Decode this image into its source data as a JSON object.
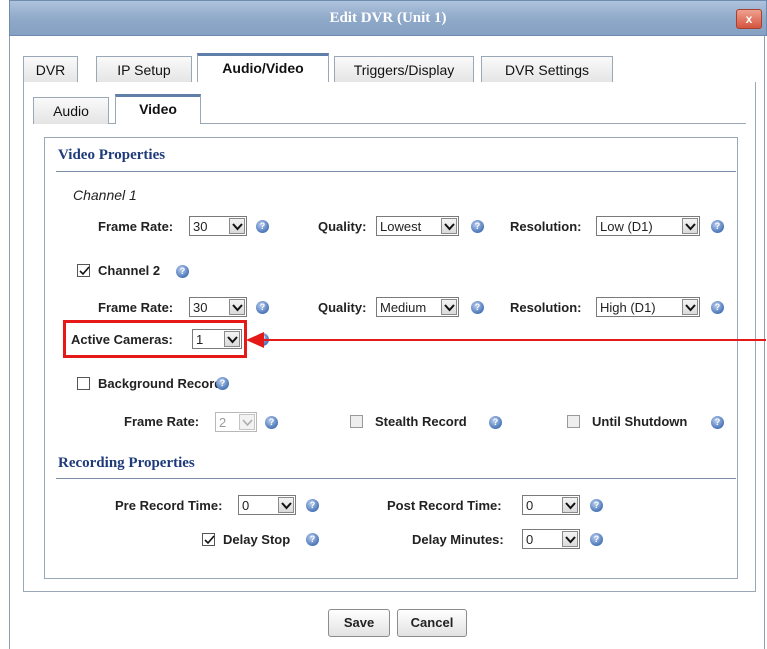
{
  "window": {
    "title": "Edit DVR (Unit 1)",
    "close_label": "x"
  },
  "tabs": [
    "DVR",
    "IP Setup",
    "Audio/Video",
    "Triggers/Display",
    "DVR Settings"
  ],
  "subtabs": [
    "Audio",
    "Video"
  ],
  "video_properties": {
    "heading": "Video Properties",
    "channel1": {
      "label": "Channel 1",
      "frame_rate_label": "Frame Rate:",
      "frame_rate": "30",
      "quality_label": "Quality:",
      "quality": "Lowest",
      "resolution_label": "Resolution:",
      "resolution": "Low (D1)"
    },
    "channel2": {
      "label": "Channel 2",
      "checked": true,
      "frame_rate_label": "Frame Rate:",
      "frame_rate": "30",
      "quality_label": "Quality:",
      "quality": "Medium",
      "resolution_label": "Resolution:",
      "resolution": "High (D1)"
    },
    "active_cameras_label": "Active Cameras:",
    "active_cameras": "1",
    "background_record": {
      "label": "Background Record",
      "checked": false,
      "frame_rate_label": "Frame Rate:",
      "frame_rate": "2",
      "stealth_label": "Stealth Record",
      "until_shutdown_label": "Until Shutdown"
    }
  },
  "recording_properties": {
    "heading": "Recording Properties",
    "pre_record_label": "Pre Record Time:",
    "pre_record": "0",
    "post_record_label": "Post Record Time:",
    "post_record": "0",
    "delay_stop_label": "Delay Stop",
    "delay_stop_checked": true,
    "delay_minutes_label": "Delay Minutes:",
    "delay_minutes": "0"
  },
  "buttons": {
    "save": "Save",
    "cancel": "Cancel"
  },
  "help_glyph": "?",
  "colors": {
    "annotation": "#e61919",
    "heading": "#1f3b7a",
    "titlebar": "#8ea8c9"
  }
}
